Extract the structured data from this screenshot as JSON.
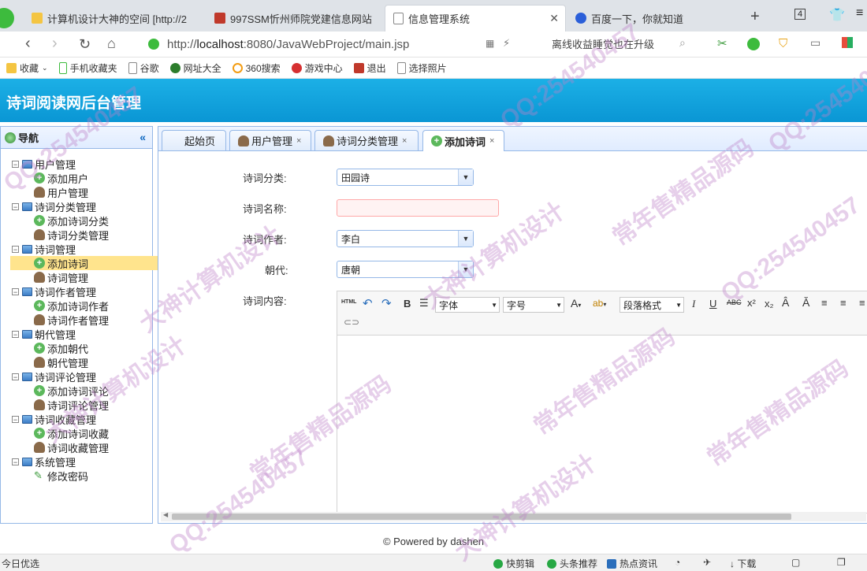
{
  "browser": {
    "tabs": [
      {
        "label": "计算机设计大神的空间 [http://2",
        "active": false
      },
      {
        "label": "997SSM忻州师院党建信息网站",
        "active": false
      },
      {
        "label": "信息管理系统",
        "active": true
      },
      {
        "label": "百度一下，你就知道",
        "active": false
      }
    ],
    "tab_count": "4",
    "url_prefix": "http://",
    "url_host": "localhost",
    "url_path": ":8080/JavaWebProject/main.jsp",
    "suggestion": "离线收益睡觉也在升级"
  },
  "bookmarks": [
    "收藏",
    "手机收藏夹",
    "谷歌",
    "网址大全",
    "360搜索",
    "游戏中心",
    "退出",
    "选择照片"
  ],
  "app": {
    "title": "诗词阅读网后台管理",
    "nav_title": "导航",
    "nav_collapse": "«"
  },
  "tree": [
    {
      "label": "用户管理"
    },
    {
      "label": "添加用户"
    },
    {
      "label": "用户管理"
    },
    {
      "label": "诗词分类管理"
    },
    {
      "label": "添加诗词分类"
    },
    {
      "label": "诗词分类管理"
    },
    {
      "label": "诗词管理"
    },
    {
      "label": "添加诗词"
    },
    {
      "label": "诗词管理"
    },
    {
      "label": "诗词作者管理"
    },
    {
      "label": "添加诗词作者"
    },
    {
      "label": "诗词作者管理"
    },
    {
      "label": "朝代管理"
    },
    {
      "label": "添加朝代"
    },
    {
      "label": "朝代管理"
    },
    {
      "label": "诗词评论管理"
    },
    {
      "label": "添加诗词评论"
    },
    {
      "label": "诗词评论管理"
    },
    {
      "label": "诗词收藏管理"
    },
    {
      "label": "添加诗词收藏"
    },
    {
      "label": "诗词收藏管理"
    },
    {
      "label": "系统管理"
    },
    {
      "label": "修改密码"
    }
  ],
  "panel_tabs": [
    "起始页",
    "用户管理",
    "诗词分类管理",
    "添加诗词"
  ],
  "form": {
    "category_label": "诗词分类:",
    "category_value": "田园诗",
    "name_label": "诗词名称:",
    "name_value": "",
    "author_label": "诗词作者:",
    "author_value": "李白",
    "dynasty_label": "朝代:",
    "dynasty_value": "唐朝",
    "content_label": "诗词内容:"
  },
  "editor": {
    "font_family": "字体",
    "font_size": "字号",
    "paragraph": "段落格式",
    "html_btn": "HTML"
  },
  "footer": "© Powered by dashen",
  "status": {
    "left": "今日优选",
    "items": [
      "快剪辑",
      "头条推荐",
      "热点资讯",
      "下载"
    ]
  },
  "watermark": [
    "QQ:254540457",
    "大神计算机设计",
    "常年售精品源码"
  ]
}
